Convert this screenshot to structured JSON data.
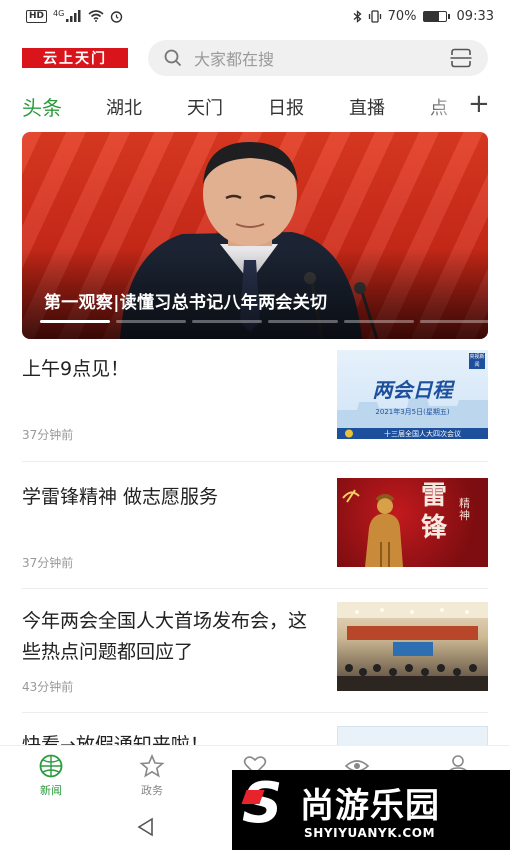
{
  "status_bar": {
    "hd": "HD",
    "network": "4G",
    "battery_percent": "70%",
    "battery_level": 0.7,
    "time": "09:33"
  },
  "header": {
    "logo_text": "云上天门",
    "search_placeholder": "大家都在搜"
  },
  "tabs": [
    {
      "label": "头条",
      "active": true
    },
    {
      "label": "湖北",
      "active": false
    },
    {
      "label": "天门",
      "active": false
    },
    {
      "label": "日报",
      "active": false
    },
    {
      "label": "直播",
      "active": false
    },
    {
      "label": "点",
      "active": false
    }
  ],
  "banner": {
    "title": "第一观察|读懂习总书记八年两会关切",
    "slide_count": 6,
    "active_slide": 1
  },
  "news": [
    {
      "title": "上午9点见！",
      "time": "37分钟前",
      "thumb": {
        "type": "schedule",
        "heading": "两会日程",
        "date": "2021年3月5日(星期五)",
        "footer": "十三届全国人大四次会议",
        "corner": "央视新闻"
      }
    },
    {
      "title": "学雷锋精神 做志愿服务",
      "time": "37分钟前",
      "thumb": {
        "type": "poster",
        "chars": "雷锋",
        "side_text": "精神"
      }
    },
    {
      "title": "今年两会全国人大首场发布会，这些热点问题都回应了",
      "time": "43分钟前",
      "thumb": {
        "type": "press"
      }
    },
    {
      "title": "快看→放假通知来啦！",
      "time": "",
      "thumb": {
        "type": "blank"
      }
    }
  ],
  "bottom_nav": [
    {
      "label": "新闻",
      "icon": "globe-icon",
      "active": true
    },
    {
      "label": "政务",
      "icon": "star-icon",
      "active": false
    },
    {
      "label": "",
      "icon": "heart-icon",
      "active": false
    },
    {
      "label": "",
      "icon": "eye-icon",
      "active": false
    },
    {
      "label": "",
      "icon": "person-icon",
      "active": false
    }
  ],
  "watermark": {
    "brand": "尚游乐园",
    "url": "SHYIYUANYK.COM"
  },
  "colors": {
    "accent_green": "#2c9c3e",
    "brand_red": "#d9151b",
    "banner_red": "#d42c1a"
  }
}
